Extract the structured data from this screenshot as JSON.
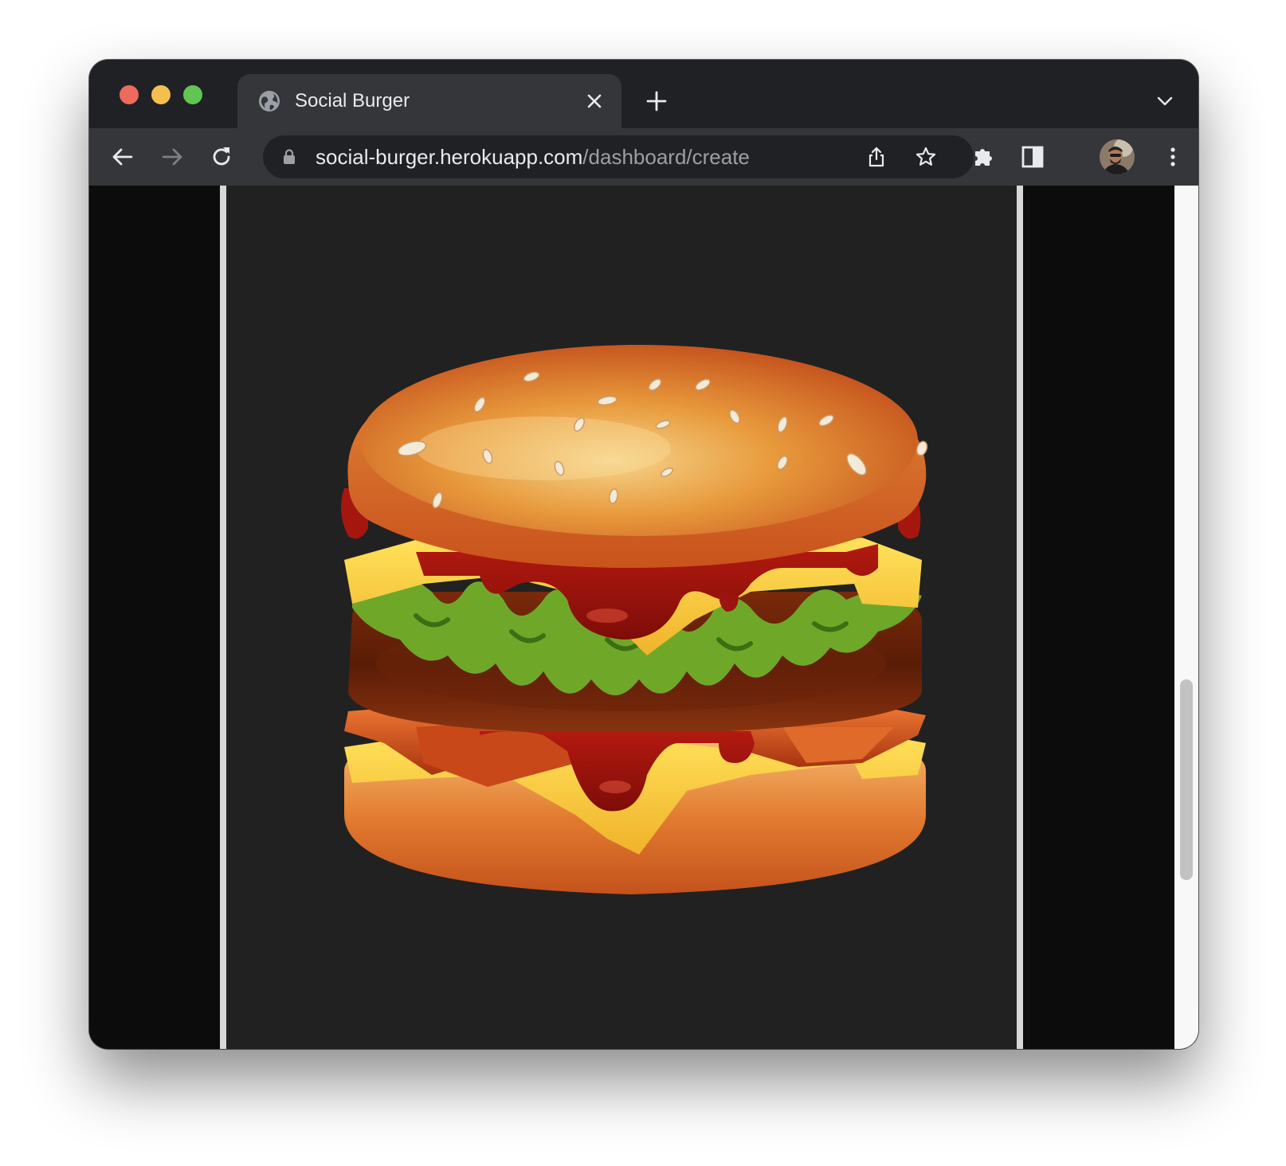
{
  "window": {
    "controls": {
      "close_color": "#ed6a5e",
      "minimize_color": "#f5bf4f",
      "maximize_color": "#61c554"
    }
  },
  "tab": {
    "title": "Social Burger",
    "favicon": "globe-icon",
    "close_icon": "close-icon"
  },
  "tabstrip": {
    "new_tab_icon": "plus-icon",
    "tab_search_icon": "chevron-down-icon"
  },
  "toolbar": {
    "back_icon": "arrow-left-icon",
    "forward_icon": "arrow-right-icon",
    "reload_icon": "reload-icon",
    "url_host": "social-burger.herokuapp.com",
    "url_path": "/dashboard/create",
    "share_icon": "share-icon",
    "bookmark_icon": "star-icon",
    "extensions_icon": "puzzle-icon",
    "side_panel_icon": "side-panel-icon",
    "menu_icon": "kebab-menu-icon"
  },
  "content": {
    "image": "burger-illustration",
    "background_color": "#212121"
  }
}
